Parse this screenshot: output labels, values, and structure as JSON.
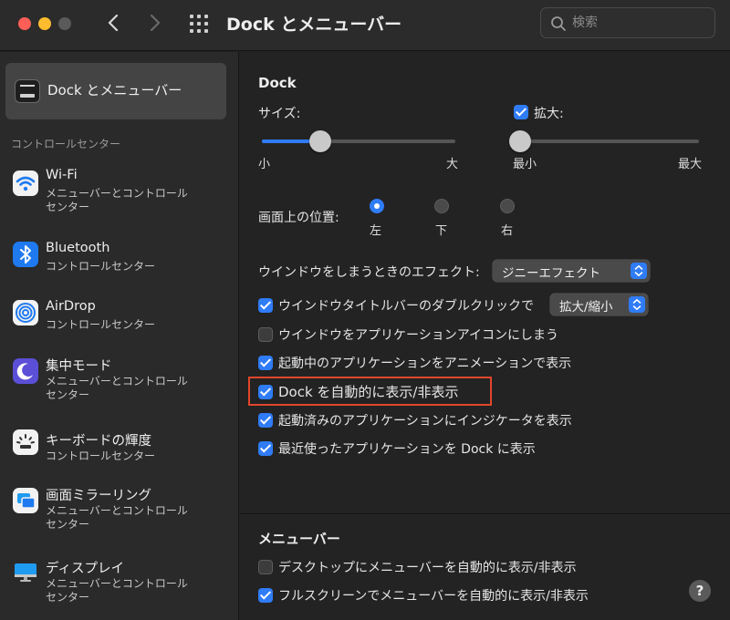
{
  "window": {
    "title": "Dock とメニューバー",
    "search_placeholder": "検索"
  },
  "sidebar": {
    "selected": {
      "label": "Dock とメニューバー"
    },
    "section_header": "コントロールセンター",
    "items": [
      {
        "title": "Wi-Fi",
        "subtitle": "メニューバーとコントロール\nセンター",
        "icon": "wifi-icon"
      },
      {
        "title": "Bluetooth",
        "subtitle": "コントロールセンター",
        "icon": "bluetooth-icon"
      },
      {
        "title": "AirDrop",
        "subtitle": "コントロールセンター",
        "icon": "airdrop-icon"
      },
      {
        "title": "集中モード",
        "subtitle": "メニューバーとコントロール\nセンター",
        "icon": "focus-moon-icon"
      },
      {
        "title": "キーボードの輝度",
        "subtitle": "コントロールセンター",
        "icon": "keyboard-brightness-icon"
      },
      {
        "title": "画面ミラーリング",
        "subtitle": "メニューバーとコントロール\nセンター",
        "icon": "screen-mirroring-icon"
      },
      {
        "title": "ディスプレイ",
        "subtitle": "メニューバーとコントロール\nセンター",
        "icon": "display-icon"
      }
    ]
  },
  "dock": {
    "heading": "Dock",
    "size": {
      "label": "サイズ:",
      "min_label": "小",
      "max_label": "大",
      "value": 0.3
    },
    "magnification": {
      "label": "拡大:",
      "checked": true,
      "min_label": "最小",
      "max_label": "最大",
      "value": 0.0
    },
    "position": {
      "label": "画面上の位置:",
      "options": [
        {
          "label": "左",
          "selected": true
        },
        {
          "label": "下",
          "selected": false
        },
        {
          "label": "右",
          "selected": false
        }
      ]
    },
    "minimize_effect": {
      "label": "ウインドウをしまうときのエフェクト:",
      "value": "ジニーエフェクト"
    },
    "double_click": {
      "label": "ウインドウタイトルバーのダブルクリックで",
      "checked": true,
      "value": "拡大/縮小"
    },
    "checkboxes": [
      {
        "label": "ウインドウをアプリケーションアイコンにしまう",
        "checked": false
      },
      {
        "label": "起動中のアプリケーションをアニメーションで表示",
        "checked": true
      },
      {
        "label": "Dock を自動的に表示/非表示",
        "checked": true
      },
      {
        "label": "起動済みのアプリケーションにインジケータを表示",
        "checked": true
      },
      {
        "label": "最近使ったアプリケーションを Dock に表示",
        "checked": true
      }
    ]
  },
  "menubar": {
    "heading": "メニューバー",
    "checkboxes": [
      {
        "label": "デスクトップにメニューバーを自動的に表示/非表示",
        "checked": false
      },
      {
        "label": "フルスクリーンでメニューバーを自動的に表示/非表示",
        "checked": true
      }
    ]
  },
  "help_label": "?",
  "colors": {
    "accent": "#2f7cf6",
    "highlight": "#e2452b"
  }
}
